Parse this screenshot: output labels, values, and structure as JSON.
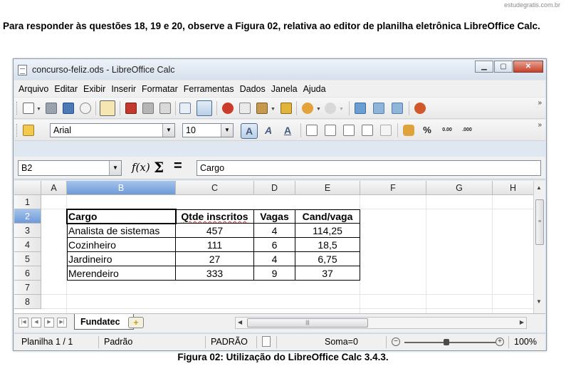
{
  "watermark": "estudegratis.com.br",
  "question_text": "Para responder às questões 18, 19 e 20, observe a Figura 02, relativa ao editor de planilha eletrônica LibreOffice Calc.",
  "window": {
    "title": "concurso-feliz.ods - LibreOffice Calc",
    "controls": {
      "minimize": "▁",
      "maximize": "▢",
      "close": "✕"
    }
  },
  "menu": [
    "Arquivo",
    "Editar",
    "Exibir",
    "Inserir",
    "Formatar",
    "Ferramentas",
    "Dados",
    "Janela",
    "Ajuda"
  ],
  "toolbar_standard": {
    "icons": [
      "new-icon",
      "open-icon",
      "save-icon",
      "email-icon",
      "edit-file-icon",
      "export-pdf-icon",
      "print-icon",
      "print-preview-icon",
      "spellcheck-icon",
      "autospellcheck-icon",
      "cut-icon",
      "copy-icon",
      "paste-icon",
      "clone-formatting-icon",
      "undo-icon",
      "redo-icon",
      "hyperlink-icon",
      "sort-ascending-icon",
      "sort-descending-icon",
      "chart-icon"
    ],
    "more": "»"
  },
  "toolbar_formatting": {
    "font_name": "Arial",
    "font_size": "10",
    "bold": "A",
    "italic": "A",
    "underline": "A",
    "percent": "%",
    "add_decimal": "0.00",
    "remove_decimal": ".000",
    "more": "»"
  },
  "formula_bar": {
    "name_box": "B2",
    "fx": "f(x)",
    "sum": "Σ",
    "equals": "=",
    "content": "Cargo"
  },
  "columns": [
    "A",
    "B",
    "C",
    "D",
    "E",
    "F",
    "G",
    "H"
  ],
  "selected_column": "B",
  "rows": [
    "1",
    "2",
    "3",
    "4",
    "5",
    "6",
    "7",
    "8"
  ],
  "selected_row": "2",
  "table": {
    "headers": [
      "Cargo",
      "Qtde inscritos",
      "Vagas",
      "Cand/vaga"
    ],
    "rows": [
      [
        "Analista de sistemas",
        "457",
        "4",
        "114,25"
      ],
      [
        "Cozinheiro",
        "111",
        "6",
        "18,5"
      ],
      [
        "Jardineiro",
        "27",
        "4",
        "6,75"
      ],
      [
        "Merendeiro",
        "333",
        "9",
        "37"
      ]
    ]
  },
  "sheet_tab": "Fundatec",
  "status_bar": {
    "sheet": "Planilha 1 / 1",
    "style": "Padrão",
    "mode": "PADRÃO",
    "sum": "Soma=0",
    "zoom_minus": "−",
    "zoom_plus": "+",
    "zoom": "100%",
    "zoom_level": 1.0
  },
  "caption": "Figura 02: Utilização do LibreOffice Calc 3.4.3."
}
